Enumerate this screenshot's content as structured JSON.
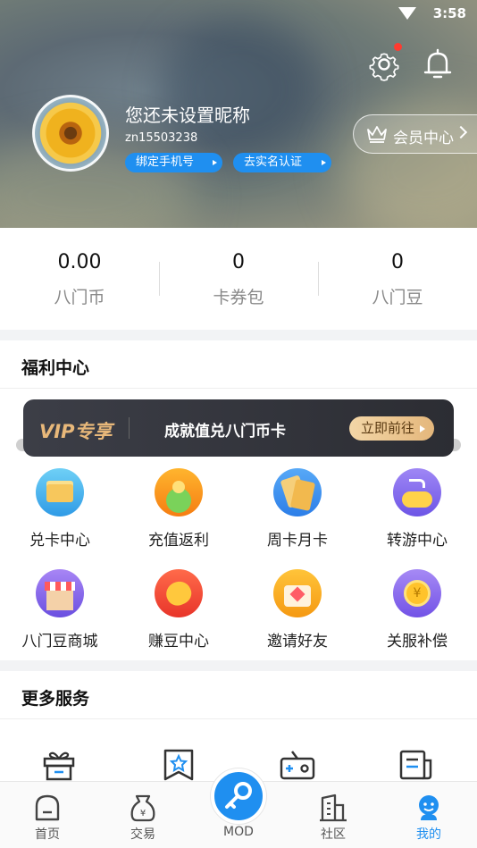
{
  "status": {
    "time": "3:58"
  },
  "profile": {
    "nickname": "您还未设置昵称",
    "user_id": "zn15503238",
    "bind_phone": "绑定手机号",
    "real_name": "去实名认证",
    "vip_center": "会员中心"
  },
  "stats": [
    {
      "value": "0.00",
      "label": "八门币"
    },
    {
      "value": "0",
      "label": "卡券包"
    },
    {
      "value": "0",
      "label": "八门豆"
    }
  ],
  "welfare": {
    "title": "福利中心",
    "banner": {
      "tag": "VIP专享",
      "text": "成就值兑八门币卡",
      "button": "立即前往"
    },
    "items": [
      {
        "label": "兑卡中心",
        "icon": "card-exchange-icon"
      },
      {
        "label": "充值返利",
        "icon": "recharge-rebate-icon"
      },
      {
        "label": "周卡月卡",
        "icon": "weekly-monthly-card-icon"
      },
      {
        "label": "转游中心",
        "icon": "game-transfer-icon"
      },
      {
        "label": "八门豆商城",
        "icon": "bean-mall-icon"
      },
      {
        "label": "赚豆中心",
        "icon": "earn-beans-icon"
      },
      {
        "label": "邀请好友",
        "icon": "invite-friends-icon"
      },
      {
        "label": "关服补偿",
        "icon": "server-compensation-icon"
      }
    ]
  },
  "more_services": {
    "title": "更多服务",
    "icons": [
      "gift-box-icon",
      "star-bookmark-icon",
      "game-controller-icon",
      "news-icon"
    ]
  },
  "nav": [
    {
      "label": "首页",
      "icon": "home-icon"
    },
    {
      "label": "交易",
      "icon": "money-bag-icon"
    },
    {
      "label": "MOD",
      "icon": "key-icon"
    },
    {
      "label": "社区",
      "icon": "buildings-icon"
    },
    {
      "label": "我的",
      "icon": "profile-mascot-icon",
      "active": true
    }
  ],
  "colors": {
    "accent": "#1f8ff0",
    "vip_gold": "#e8b87a",
    "badge_red": "#ff3b30"
  }
}
